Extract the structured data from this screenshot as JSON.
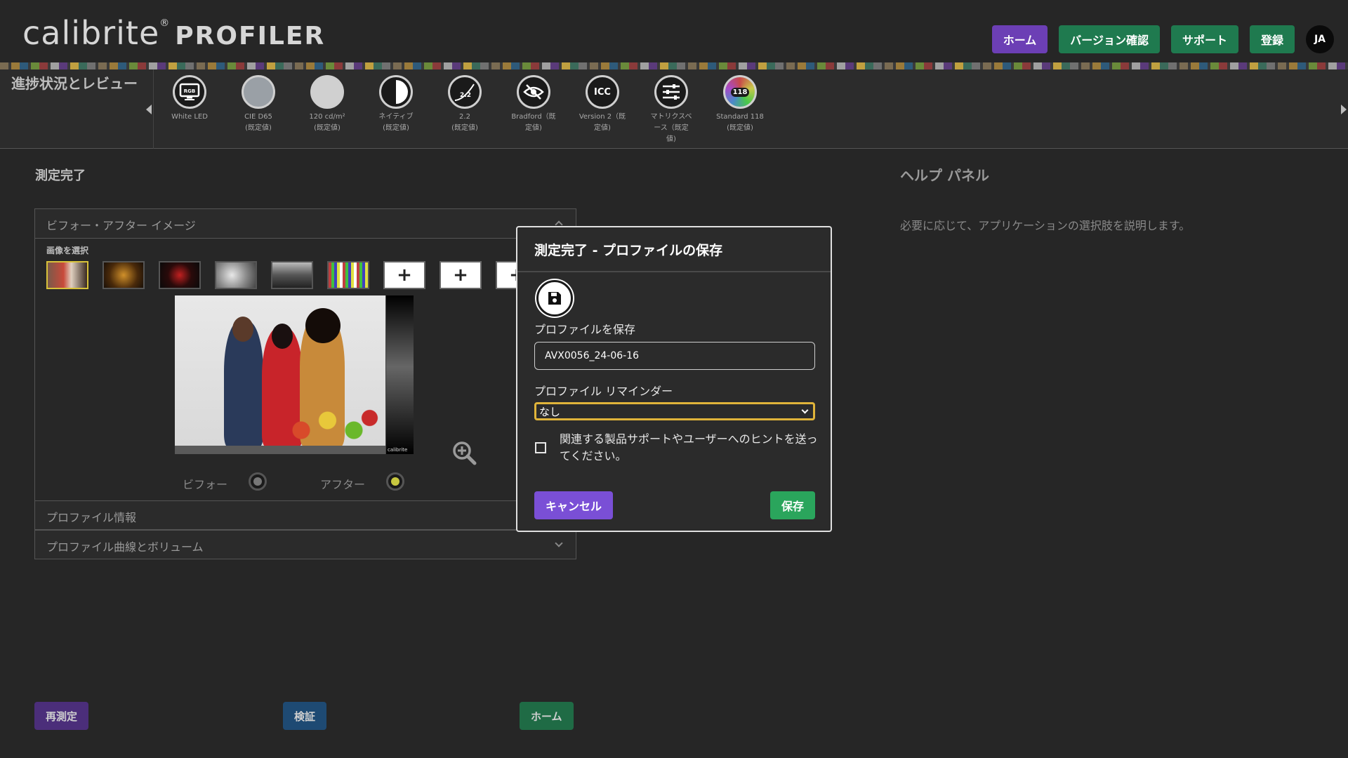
{
  "app": {
    "logo_main": "calibrite",
    "logo_reg": "®",
    "logo_sub": "PROFILER"
  },
  "nav": {
    "home": "ホーム",
    "version": "バージョン確認",
    "support": "サポート",
    "register": "登録",
    "language": "JA"
  },
  "progress": {
    "title": "進捗状況とレビュー",
    "steps": [
      {
        "icon": "RGB",
        "line1": "White LED",
        "line2": ""
      },
      {
        "icon": "",
        "line1": "CIE D65",
        "line2": "(既定値)"
      },
      {
        "icon": "",
        "line1": "120 cd/m²",
        "line2": "(既定値)"
      },
      {
        "icon": "",
        "line1": "ネイティブ",
        "line2": "(既定値)"
      },
      {
        "icon": "2.2",
        "line1": "2.2",
        "line2": "(既定値)"
      },
      {
        "icon": "",
        "line1": "Bradford（既",
        "line2": "定値)"
      },
      {
        "icon": "ICC",
        "line1": "Version 2（既",
        "line2": "定値)"
      },
      {
        "icon": "",
        "line1": "マトリクスベ",
        "line2": "ース（既定",
        "line3": "値)"
      },
      {
        "icon": "118",
        "line1": "Standard 118",
        "line2": "(既定値)"
      }
    ]
  },
  "main": {
    "section_title": "測定完了",
    "before_after": {
      "header": "ビフォー・アフター イメージ",
      "select_label": "画像を選択",
      "add_label": "+",
      "brand": "calibrite",
      "before_label": "ビフォー",
      "after_label": "アフター"
    },
    "profile_info": "プロファイル情報",
    "profile_curves": "プロファイル曲線とボリューム",
    "buttons": {
      "remeasure": "再測定",
      "verify": "検証",
      "home": "ホーム"
    }
  },
  "help": {
    "title": "ヘルプ パネル",
    "text": "必要に応じて、アプリケーションの選択肢を説明します。"
  },
  "modal": {
    "title": "測定完了 - プロファイルの保存",
    "save_profile_label": "プロファイルを保存",
    "profile_name": "AVX0056_24-06-16",
    "reminder_label": "プロファイル リマインダー",
    "reminder_value": "なし",
    "hint_text": "関連する製品サポートやユーザーへのヒントを送ってください。",
    "cancel": "キャンセル",
    "save": "保存"
  },
  "colors": {
    "background": "#262626",
    "nav_purple": "#6c3fb5",
    "nav_green": "#1f7a4f",
    "modal_cancel": "#7a4fd6",
    "modal_save": "#2aa55c",
    "select_focus": "#e0b43a",
    "thumb_selected": "#d8c23a"
  }
}
